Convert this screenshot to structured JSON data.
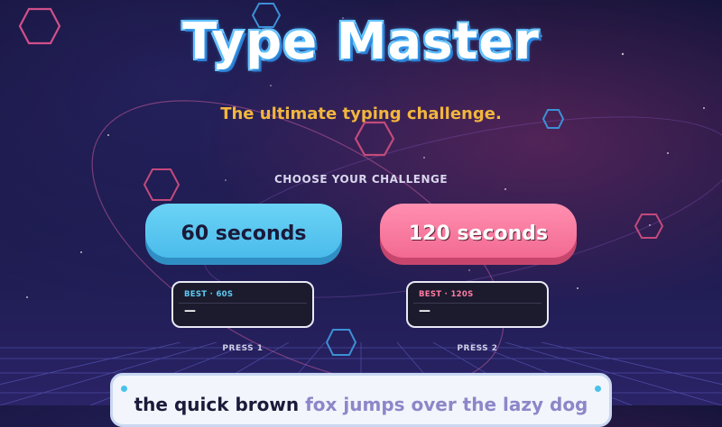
{
  "title": "Type Master",
  "subtitle": "The ultimate typing challenge.",
  "choose_label": "CHOOSE YOUR CHALLENGE",
  "colors": {
    "accent_blue": "#5cc8f2",
    "accent_pink": "#f7739b",
    "subtitle_gold": "#f2b63d",
    "background": "#1b1a4b"
  },
  "challenges": [
    {
      "button_label": "60 seconds",
      "best_label": "BEST · 60S",
      "best_value": "—",
      "hint": "PRESS 1"
    },
    {
      "button_label": "120 seconds",
      "best_label": "BEST · 120S",
      "best_value": "—",
      "hint": "PRESS 2"
    }
  ],
  "typing_card": {
    "typed_text": "the quick brown",
    "untyped_text": " fox jumps over the lazy dog"
  }
}
